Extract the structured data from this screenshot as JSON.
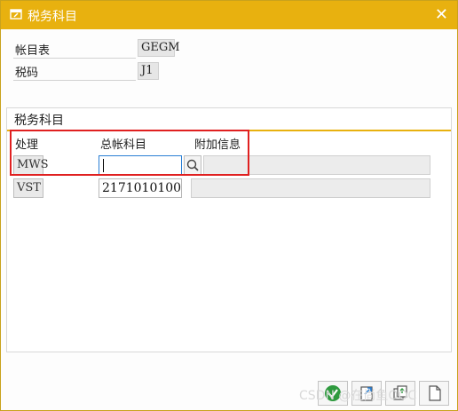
{
  "window": {
    "title": "税务科目"
  },
  "header": {
    "account_table_label": "帐目表",
    "account_table_value": "GEGM",
    "tax_code_label": "税码",
    "tax_code_value": "J1"
  },
  "group": {
    "title": "税务科目",
    "columns": [
      "处理",
      "总帐科目",
      "附加信息"
    ],
    "rows": [
      {
        "process": "MWS",
        "gl_account": "",
        "extra": ""
      },
      {
        "process": "VST",
        "gl_account": "2171010100",
        "extra": ""
      }
    ]
  },
  "watermark": "CSDN @在尚鱼OOC",
  "colors": {
    "title_bar": "#e8b10f",
    "highlight": "#e02020",
    "focus": "#2a7fd4"
  },
  "icons": [
    "edit-window-icon",
    "close-icon",
    "search-icon",
    "confirm-icon",
    "export-icon",
    "copy-icon",
    "new-icon"
  ]
}
